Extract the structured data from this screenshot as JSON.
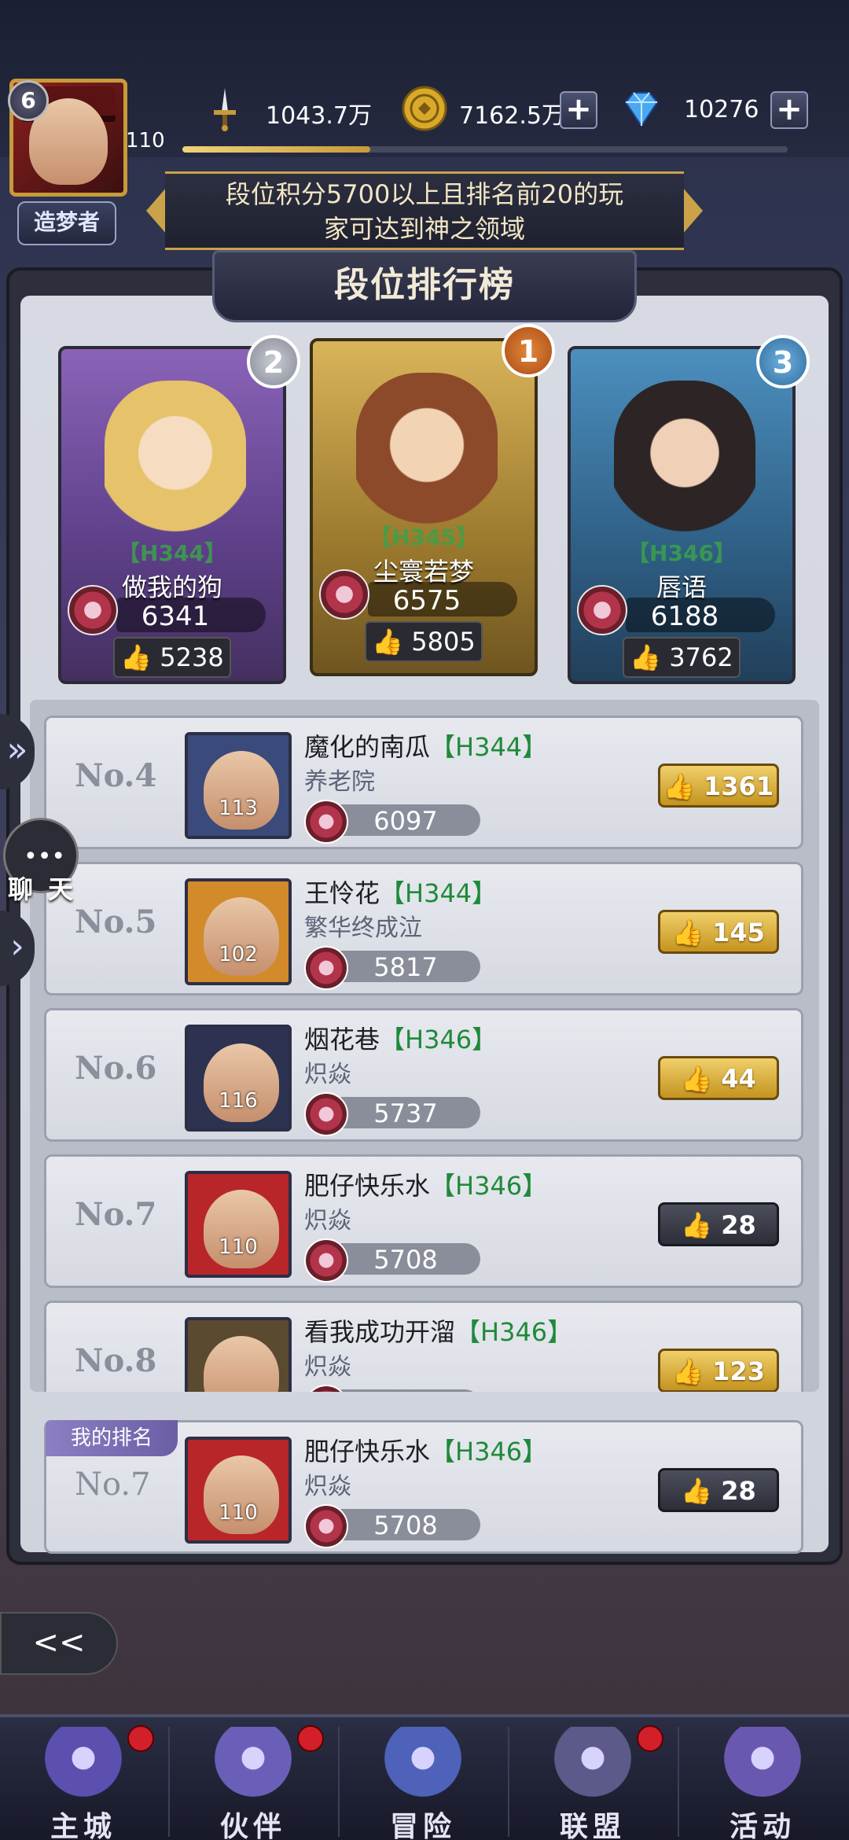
{
  "player": {
    "vip": "6",
    "level": "110",
    "title": "造梦者",
    "exp_fraction": 0.31
  },
  "resources": [
    {
      "icon": "sword-icon",
      "value": "1043.7万"
    },
    {
      "icon": "gold-coin-icon",
      "value": "7162.5万"
    },
    {
      "icon": "diamond-icon",
      "value": "10276"
    }
  ],
  "notice": {
    "line1": "段位积分5700以上且排名前20的玩",
    "line2": "家可达到神之领域"
  },
  "panel_title": "段位排行榜",
  "podium": [
    {
      "medal": "2",
      "server": "【H344】",
      "name": "做我的狗",
      "score": "6341",
      "likes": "5238"
    },
    {
      "medal": "1",
      "server": "【H345】",
      "name": "尘寰若梦",
      "score": "6575",
      "likes": "5805"
    },
    {
      "medal": "3",
      "server": "【H346】",
      "name": "唇语",
      "score": "6188",
      "likes": "3762"
    }
  ],
  "ranking": [
    {
      "rank": "No.4",
      "name": "魔化的南瓜",
      "server": "【H344】",
      "guild": "养老院",
      "level": "113",
      "score": "6097",
      "likes": "1361",
      "like_style": "gold",
      "frame_color": "#3a4a7a"
    },
    {
      "rank": "No.5",
      "name": "王怜花",
      "server": "【H344】",
      "guild": "繁华终成泣",
      "level": "102",
      "score": "5817",
      "likes": "145",
      "like_style": "gold",
      "frame_color": "#d28a2a"
    },
    {
      "rank": "No.6",
      "name": "烟花巷",
      "server": "【H346】",
      "guild": "炽焱",
      "level": "116",
      "score": "5737",
      "likes": "44",
      "like_style": "gold",
      "frame_color": "#2c3250"
    },
    {
      "rank": "No.7",
      "name": "肥仔快乐水",
      "server": "【H346】",
      "guild": "炽焱",
      "level": "110",
      "score": "5708",
      "likes": "28",
      "like_style": "dark",
      "frame_color": "#b8262a"
    },
    {
      "rank": "No.8",
      "name": "看我成功开溜",
      "server": "【H346】",
      "guild": "炽焱",
      "level": "",
      "score": "",
      "likes": "123",
      "like_style": "gold",
      "frame_color": "#5a4a30"
    }
  ],
  "my_rank": {
    "tag": "我的排名",
    "rank": "No.7",
    "name": "肥仔快乐水",
    "server": "【H346】",
    "guild": "炽焱",
    "level": "110",
    "score": "5708",
    "likes": "28"
  },
  "chat_label": "聊 天",
  "chat_dots": "•••",
  "back_icon": "back-arrow-icon",
  "side_arrow_glyph": "»",
  "side_arrow_glyph2": "›",
  "nav": [
    {
      "label": "主城",
      "icon": "castle-icon",
      "dot": true,
      "color": "#5b4fb0"
    },
    {
      "label": "伙伴",
      "icon": "witch-hat-icon",
      "dot": true,
      "color": "#6a5fb8"
    },
    {
      "label": "冒险",
      "icon": "compass-icon",
      "dot": false,
      "color": "#4d62b8"
    },
    {
      "label": "联盟",
      "icon": "shield-icon",
      "dot": true,
      "color": "#5b5a8a"
    },
    {
      "label": "活动",
      "icon": "cards-icon",
      "dot": false,
      "color": "#6a58b0"
    }
  ]
}
